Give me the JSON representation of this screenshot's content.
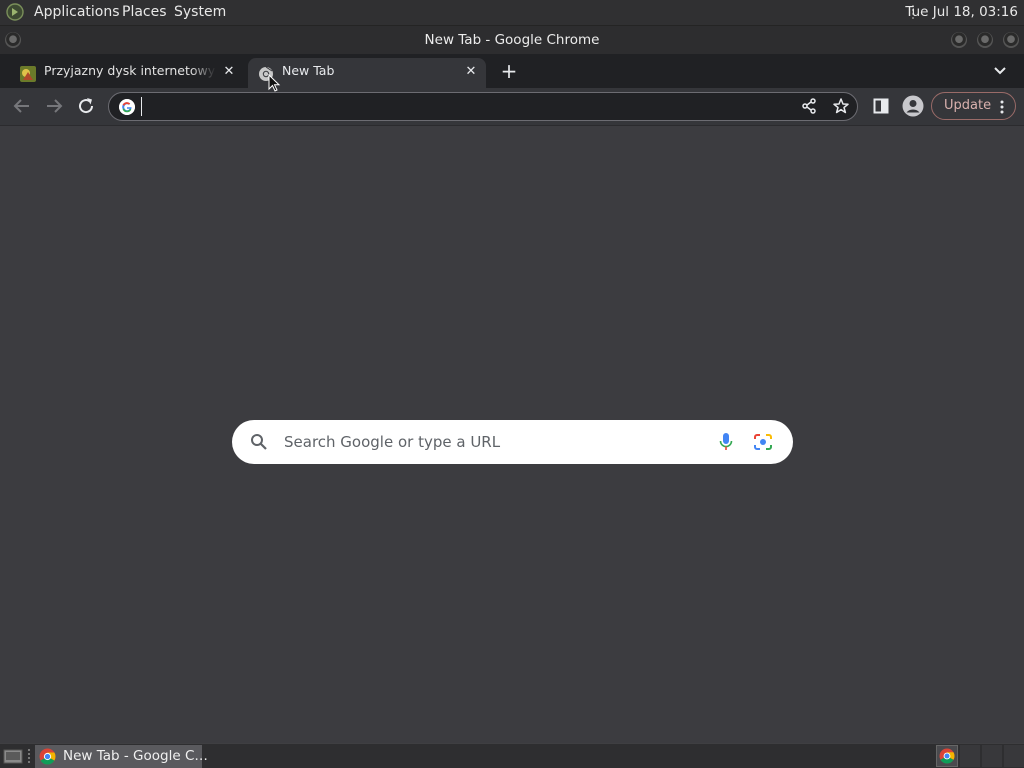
{
  "top_panel": {
    "menus": [
      "Applications",
      "Places",
      "System"
    ],
    "clock": "Tue Jul 18, 03:16"
  },
  "window": {
    "title": "New Tab - Google Chrome"
  },
  "tabs": [
    {
      "title": "Przyjazny dysk internetowy - C",
      "active": false,
      "favicon": "drive-site-favicon-icon"
    },
    {
      "title": "New Tab",
      "active": true,
      "favicon": "chrome-icon"
    }
  ],
  "toolbar": {
    "omnibox_value": "",
    "update_label": "Update"
  },
  "new_tab_page": {
    "search_placeholder": "Search Google or type a URL"
  },
  "taskbar": {
    "window_label": "New Tab - Google C…"
  },
  "colors": {
    "page_background": "#3c3c40",
    "tab_strip": "#202124",
    "toolbar": "#35363a",
    "update_accent": "#d9b1ae"
  }
}
